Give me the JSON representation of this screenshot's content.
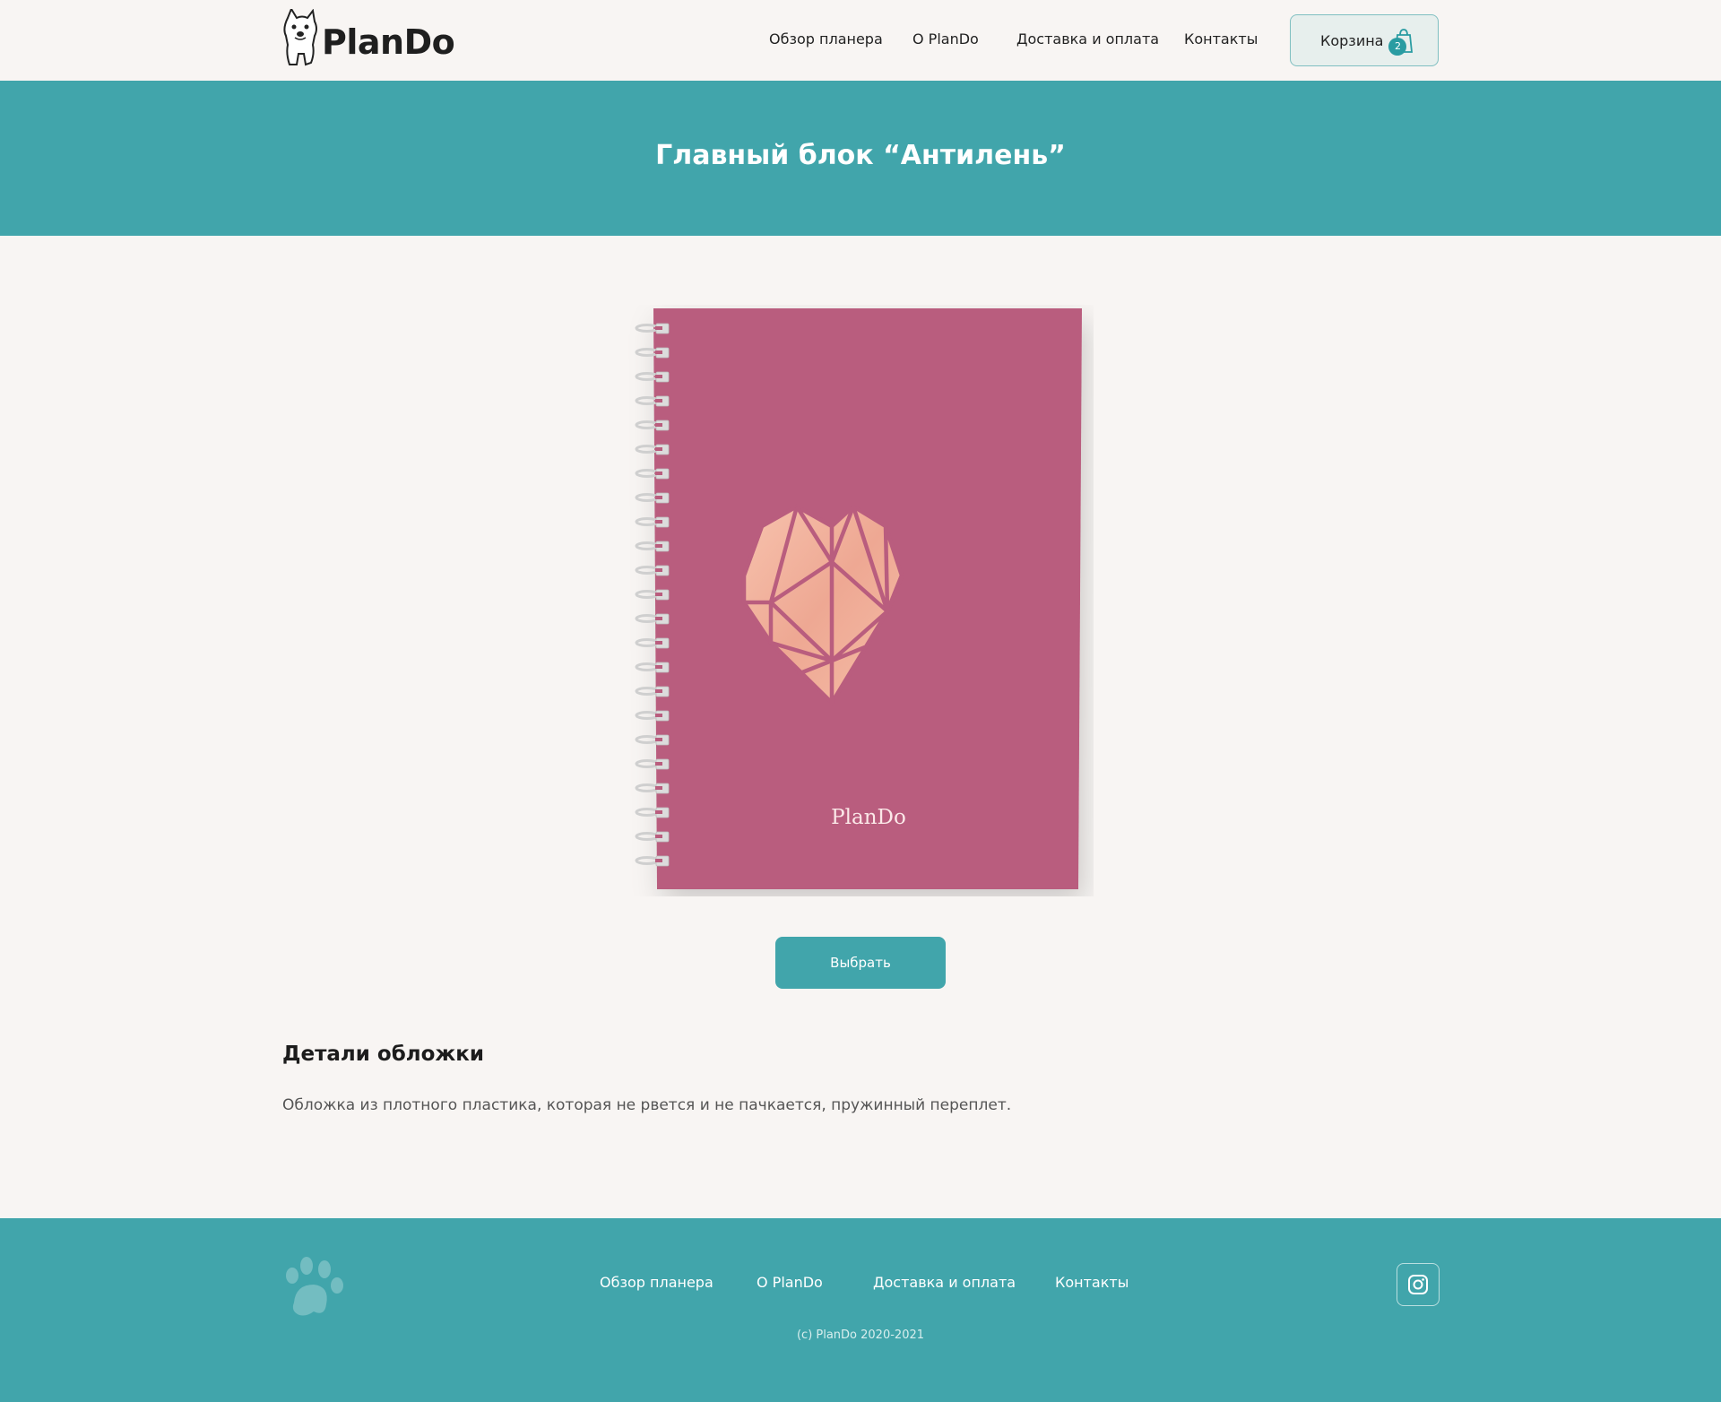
{
  "header": {
    "logo_text": "PlanDo",
    "nav": [
      "Обзор планера",
      "О PlanDo",
      "Доставка и оплата",
      "Контакты"
    ],
    "cart_label": "Корзина",
    "cart_count": "2"
  },
  "hero": {
    "title": "Главный блок “Антилень”"
  },
  "product": {
    "cover_brand": "PlanDo",
    "choose_label": "Выбрать",
    "details_title": "Детали обложки",
    "details_text": "Обложка из плотного пластика, которая не рвется и не пачкается, пружинный переплет."
  },
  "footer": {
    "nav": [
      "Обзор планера",
      "О PlanDo",
      "Доставка и оплата",
      "Контакты"
    ],
    "copyright": "(c) PlanDo 2020-2021"
  },
  "colors": {
    "accent": "#41a5ab",
    "cover": "#b95d7e",
    "heart": "#f2b4a0",
    "background": "#f8f5f3"
  },
  "icons": [
    "dog-logo-icon",
    "bag-icon",
    "spiral-binding-icon",
    "heart-icon",
    "paw-icon",
    "instagram-icon"
  ]
}
